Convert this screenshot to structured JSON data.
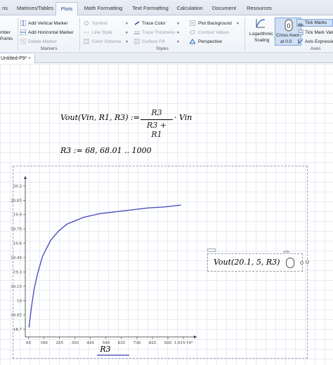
{
  "tabs": [
    {
      "label": "ns",
      "active": false
    },
    {
      "label": "Matrices/Tables",
      "active": false
    },
    {
      "label": "Plots",
      "active": true
    },
    {
      "label": "Math Formatting",
      "active": false
    },
    {
      "label": "Text Formatting",
      "active": false
    },
    {
      "label": "Calculation",
      "active": false
    },
    {
      "label": "Document",
      "active": false
    },
    {
      "label": "Resources",
      "active": false
    }
  ],
  "ribbon": {
    "points_line1": "mber",
    "points_line2": "Points",
    "add_vertical_marker": "Add Vertical Marker",
    "add_horizontal_marker": "Add Horizontal Marker",
    "delete_marker": "Delete Marker",
    "markers_group": "Markers",
    "symbol": "Symbol",
    "line_style": "Line Style",
    "color_scheme": "Color Scheme",
    "trace_color": "Trace Color",
    "trace_thickness": "Trace Thickness",
    "surface_fill": "Surface Fill",
    "plot_background": "Plot Background",
    "contour_values": "Contour Values",
    "perspective": "Perspective",
    "styles_group": "Styles",
    "log_scaling_line1": "Logarithmic",
    "log_scaling_line2": "Scaling",
    "cross_axes_line1": "Cross Axes",
    "cross_axes_line2": "at 0.0",
    "tick_marks": "Tick Marks",
    "tick_mark_values": "Tick Mark Valu",
    "axis_expressions": "Axis Expressio",
    "axes_group": "Axes",
    "cross_axes_icon_value": "0"
  },
  "document": {
    "tab_label": "Untitled-P9*",
    "close_glyph": "×"
  },
  "math": {
    "definition_lhs": "Vout(Vin, R1, R3) :=",
    "numerator": "R3",
    "denominator": "R3 + R1",
    "times_vin": "· Vin",
    "range_def": "R3 := 68, 68.01 .. 1000",
    "eval_expr": "Vout(20.1, 5, R3)",
    "eval_units_label": "units"
  },
  "chart_data": {
    "type": "line",
    "xlabel": "R3",
    "xlim": [
      68,
      1000
    ],
    "ylim": [
      18.62,
      20.28
    ],
    "x_ticks": [
      {
        "v": 65,
        "label": "65"
      },
      {
        "v": 160,
        "label": "160"
      },
      {
        "v": 255,
        "label": "255"
      },
      {
        "v": 350,
        "label": "350"
      },
      {
        "v": 445,
        "label": "445"
      },
      {
        "v": 540,
        "label": "540"
      },
      {
        "v": 635,
        "label": "635"
      },
      {
        "v": 730,
        "label": "730"
      },
      {
        "v": 825,
        "label": "825"
      },
      {
        "v": 920,
        "label": "920"
      },
      {
        "v": 1015,
        "label": "1.015·10³"
      }
    ],
    "y_ticks": [
      {
        "v": 18.7,
        "label": "18.7"
      },
      {
        "v": 18.85,
        "label": "18.85"
      },
      {
        "v": 19,
        "label": "19"
      },
      {
        "v": 19.15,
        "label": "19.15"
      },
      {
        "v": 19.3,
        "label": "19.3"
      },
      {
        "v": 19.45,
        "label": "19.45"
      },
      {
        "v": 19.6,
        "label": "19.6"
      },
      {
        "v": 19.75,
        "label": "19.75"
      },
      {
        "v": 19.9,
        "label": "19.9"
      },
      {
        "v": 20.05,
        "label": "20.05"
      },
      {
        "v": 20.2,
        "label": "20.2"
      }
    ],
    "series": [
      {
        "color": "#4b4fc0",
        "x": [
          68,
          75,
          85,
          100,
          120,
          150,
          200,
          250,
          300,
          400,
          500,
          600,
          700,
          800,
          900,
          1000
        ],
        "y": [
          18.72,
          18.83,
          18.96,
          19.13,
          19.28,
          19.46,
          19.63,
          19.73,
          19.8,
          19.87,
          19.91,
          19.93,
          19.95,
          19.97,
          19.98,
          20.0
        ]
      }
    ]
  }
}
